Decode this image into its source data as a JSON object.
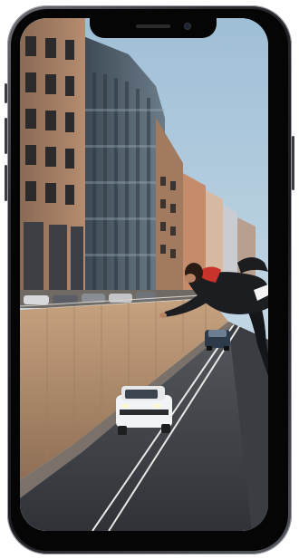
{
  "device": {
    "type": "smartphone",
    "frame_color": "#2b2d31"
  },
  "scene": {
    "subject": "person-leaping-over-wall",
    "vehicles": [
      "white-suv",
      "dark-car"
    ]
  }
}
